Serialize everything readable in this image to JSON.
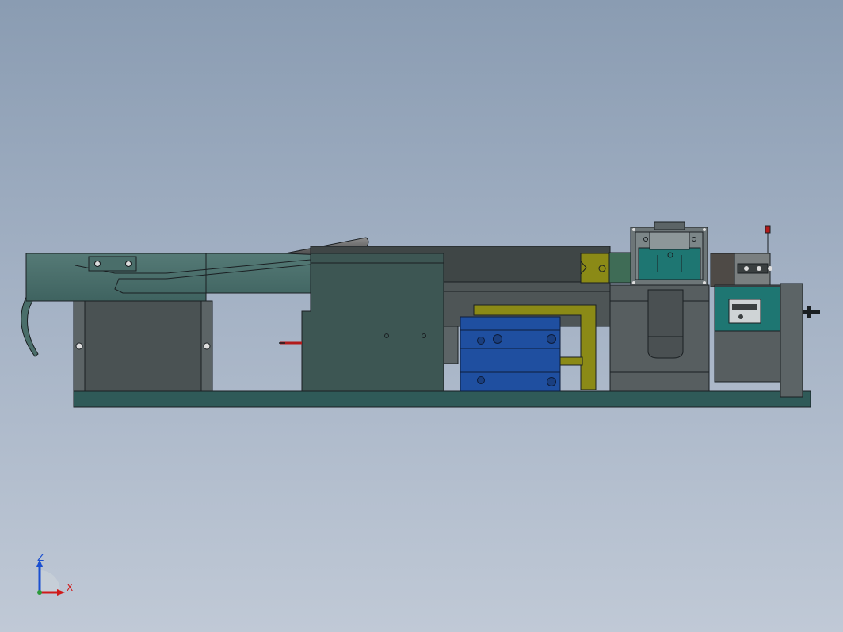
{
  "viewport": {
    "background_top": "#8a9cb2",
    "background_bottom": "#c0c9d6"
  },
  "model": {
    "colors": {
      "frame_dark_green": "#2f5a58",
      "chute_green": "#4a6e6a",
      "block_dark": "#3d4d4b",
      "gray_block": "#5c6466",
      "cylinder_blue": "#1f4fa0",
      "bracket_olive": "#8b8a16",
      "teal_block": "#1e7672",
      "red_pin": "#b21a1a",
      "edge": "#1a1f22"
    }
  },
  "triad": {
    "z_label": "Z",
    "x_label": "X",
    "z_color": "#1a4fd0",
    "x_color": "#d01a1a"
  }
}
